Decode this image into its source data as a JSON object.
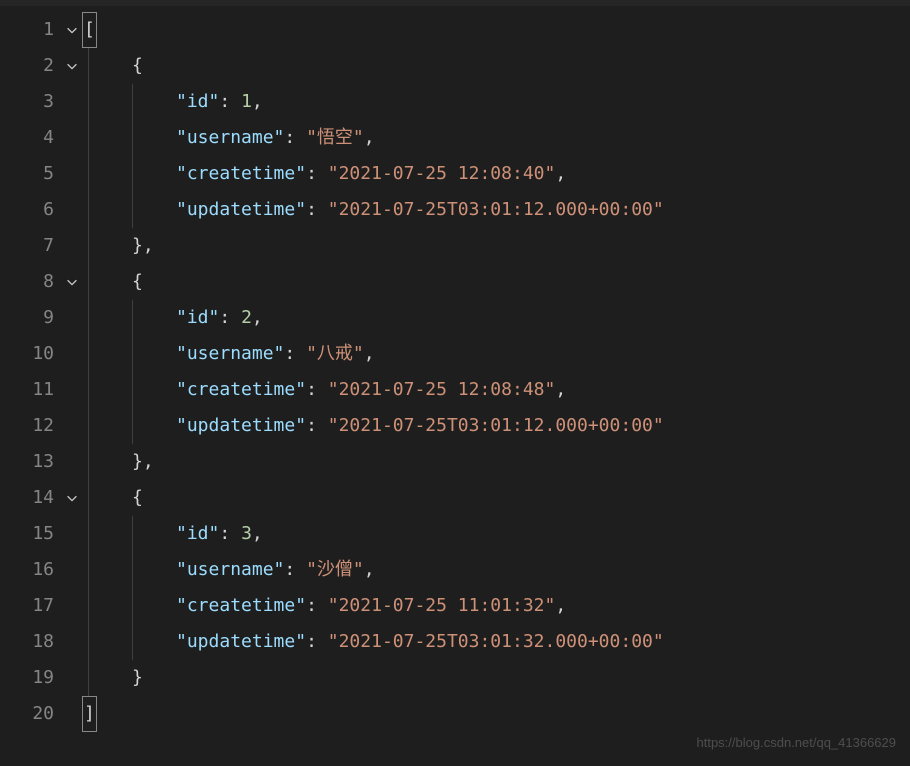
{
  "records": [
    {
      "id": 1,
      "username": "悟空",
      "createtime": "2021-07-25 12:08:40",
      "updatetime": "2021-07-25T03:01:12.000+00:00"
    },
    {
      "id": 2,
      "username": "八戒",
      "createtime": "2021-07-25 12:08:48",
      "updatetime": "2021-07-25T03:01:12.000+00:00"
    },
    {
      "id": 3,
      "username": "沙僧",
      "createtime": "2021-07-25 11:01:32",
      "updatetime": "2021-07-25T03:01:32.000+00:00"
    }
  ],
  "keys": {
    "id": "id",
    "username": "username",
    "createtime": "createtime",
    "updatetime": "updatetime"
  },
  "lineNumbers": [
    "1",
    "2",
    "3",
    "4",
    "5",
    "6",
    "7",
    "8",
    "9",
    "10",
    "11",
    "12",
    "13",
    "14",
    "15",
    "16",
    "17",
    "18",
    "19",
    "20"
  ],
  "watermark": "https://blog.csdn.net/qq_41366629"
}
